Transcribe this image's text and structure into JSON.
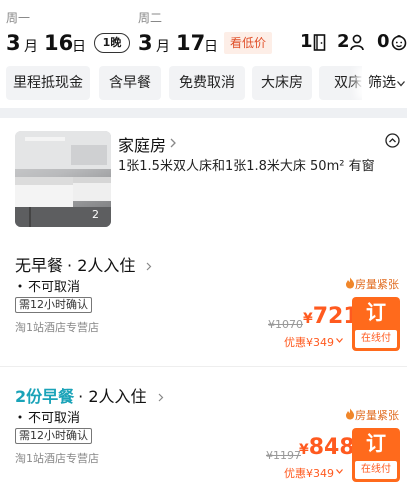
{
  "header": {
    "checkin": {
      "weekday": "周一",
      "month": "3",
      "month_unit": "月",
      "day": "16",
      "day_unit": "日"
    },
    "nights": "1晚",
    "checkout": {
      "weekday": "周二",
      "month": "3",
      "month_unit": "月",
      "day": "17",
      "day_unit": "日"
    },
    "low_price": "看低价",
    "rooms_count": "1",
    "adults_count": "2",
    "children_count": "0"
  },
  "filters": {
    "chips": [
      "里程抵现金",
      "含早餐",
      "免费取消",
      "大床房",
      "双床"
    ],
    "filter_label": "筛选"
  },
  "room": {
    "name": "家庭房",
    "desc": "1张1.5米双人床和1张1.8米大床  50m² 有窗",
    "photo_count": "2"
  },
  "rates": [
    {
      "breakfast": "无早餐",
      "guests": "· 2人入住",
      "cancel": "不可取消",
      "confirm": "需12小时确认",
      "shop": "淘1站酒店专营店",
      "scarce": "房量紧张",
      "orig_price": "¥1070",
      "currency": "¥",
      "price": "721",
      "discount": "优惠¥349",
      "book": "订",
      "pay": "在线付"
    },
    {
      "breakfast": "2份早餐",
      "guests": "· 2人入住",
      "cancel": "不可取消",
      "confirm": "需12小时确认",
      "shop": "淘1站酒店专营店",
      "scarce": "房量紧张",
      "orig_price": "¥1197",
      "currency": "¥",
      "price": "848",
      "discount": "优惠¥349",
      "book": "订",
      "pay": "在线付"
    }
  ],
  "colors": {
    "accent": "#ff6a1c",
    "price": "#ff5a1f",
    "breakfast_highlight": "#1aa3b8",
    "scarce": "#e06a1e"
  }
}
